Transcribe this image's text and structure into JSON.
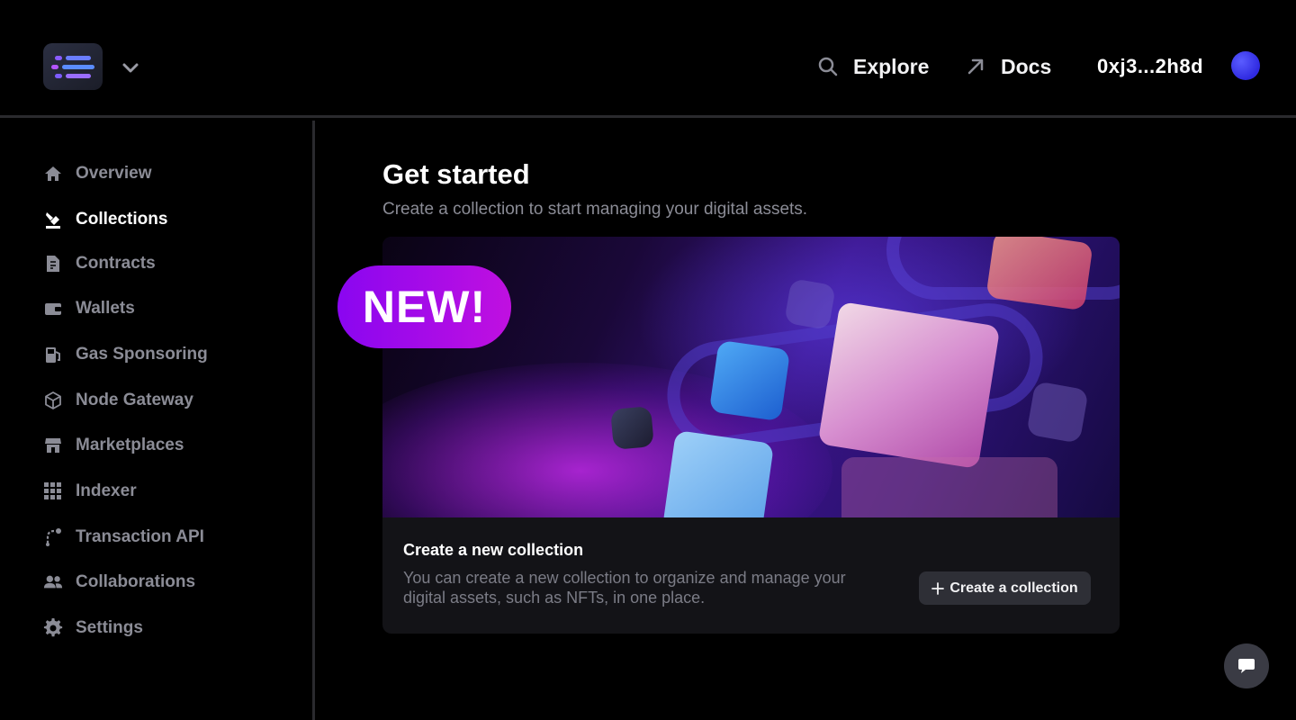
{
  "header": {
    "explore_label": "Explore",
    "docs_label": "Docs",
    "wallet_address": "0xj3...2h8d"
  },
  "sidebar": {
    "items": [
      {
        "label": "Overview",
        "icon": "home-icon",
        "active": false
      },
      {
        "label": "Collections",
        "icon": "collections-icon",
        "active": true
      },
      {
        "label": "Contracts",
        "icon": "contract-icon",
        "active": false
      },
      {
        "label": "Wallets",
        "icon": "wallet-icon",
        "active": false
      },
      {
        "label": "Gas Sponsoring",
        "icon": "gas-pump-icon",
        "active": false
      },
      {
        "label": "Node Gateway",
        "icon": "cube-icon",
        "active": false
      },
      {
        "label": "Marketplaces",
        "icon": "store-icon",
        "active": false
      },
      {
        "label": "Indexer",
        "icon": "grid-icon",
        "active": false
      },
      {
        "label": "Transaction API",
        "icon": "route-icon",
        "active": false
      },
      {
        "label": "Collaborations",
        "icon": "users-icon",
        "active": false
      },
      {
        "label": "Settings",
        "icon": "gear-icon",
        "active": false
      }
    ]
  },
  "main": {
    "title": "Get started",
    "subtitle": "Create a collection to start managing your digital assets.",
    "badge": "NEW!",
    "card": {
      "title": "Create a new collection",
      "description": "You can create a new collection to organize and manage your digital assets, such as NFTs, in one place.",
      "button_label": "Create a collection"
    }
  },
  "colors": {
    "background": "#000000",
    "accent": "#a00ae8",
    "muted_text": "#8b8c96"
  }
}
